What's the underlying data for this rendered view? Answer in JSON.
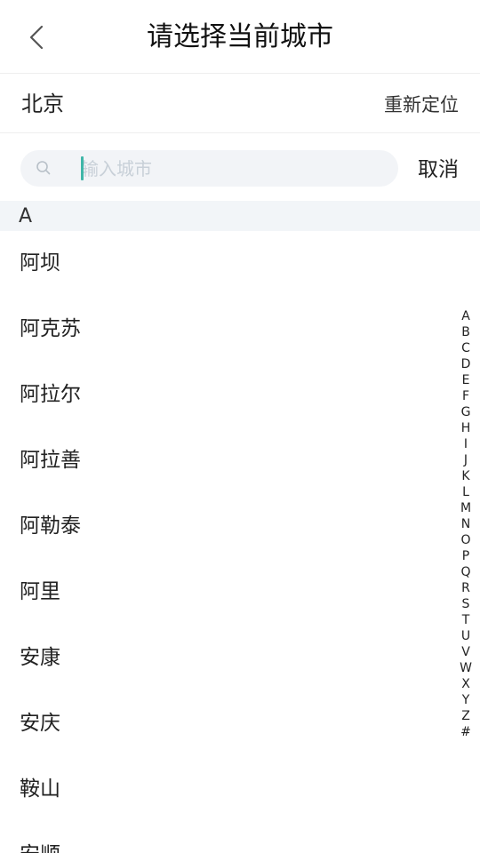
{
  "header": {
    "title": "请选择当前城市",
    "back_icon": "chevron-left-icon"
  },
  "location": {
    "current_city": "北京",
    "relocate_label": "重新定位"
  },
  "search": {
    "placeholder": "输入城市",
    "value": "",
    "icon": "search-icon",
    "cancel_label": "取消",
    "accent_color": "#3fb6a8"
  },
  "section": {
    "letter": "A"
  },
  "cities": [
    {
      "name": "阿坝"
    },
    {
      "name": "阿克苏"
    },
    {
      "name": "阿拉尔"
    },
    {
      "name": "阿拉善"
    },
    {
      "name": "阿勒泰"
    },
    {
      "name": "阿里"
    },
    {
      "name": "安康"
    },
    {
      "name": "安庆"
    },
    {
      "name": "鞍山"
    },
    {
      "name": "安顺"
    }
  ],
  "index_letters": [
    "A",
    "B",
    "C",
    "D",
    "E",
    "F",
    "G",
    "H",
    "I",
    "J",
    "K",
    "L",
    "M",
    "N",
    "O",
    "P",
    "Q",
    "R",
    "S",
    "T",
    "U",
    "V",
    "W",
    "X",
    "Y",
    "Z",
    "#"
  ]
}
